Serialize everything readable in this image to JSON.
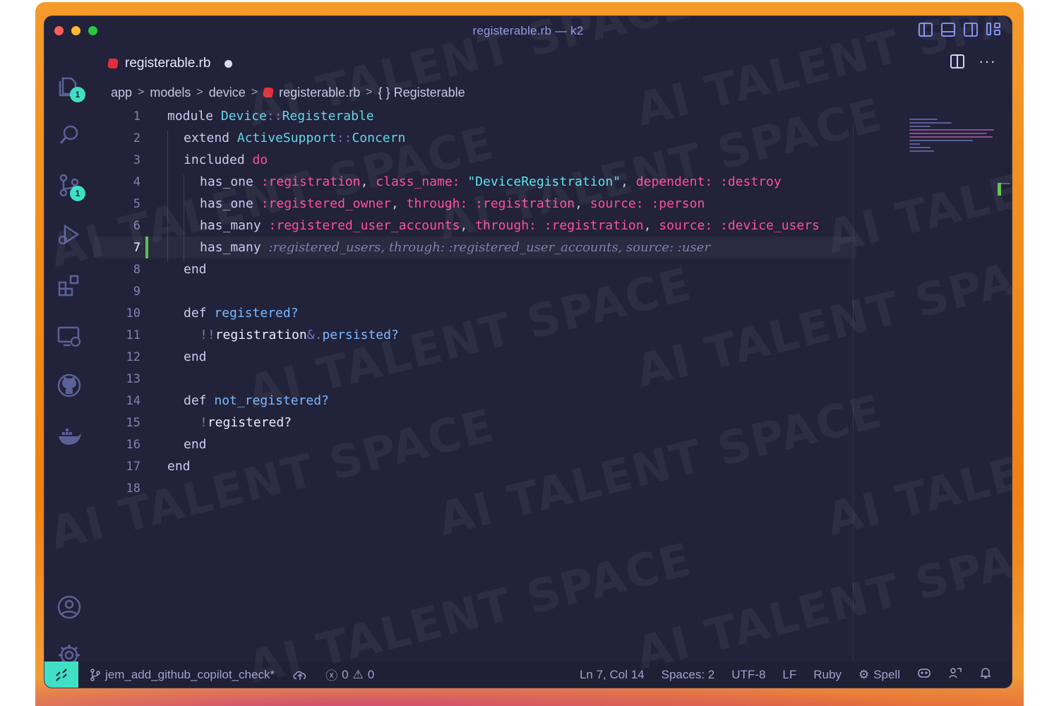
{
  "window": {
    "title": "registerable.rb — k2"
  },
  "tab": {
    "filename": "registerable.rb"
  },
  "breadcrumb": {
    "items": [
      "app",
      "models",
      "device",
      "registerable.rb",
      "{ } Registerable"
    ]
  },
  "activity": {
    "explorer_badge": "1",
    "scm_badge": "1"
  },
  "editor": {
    "lines": [
      {
        "num": "1"
      },
      {
        "num": "2"
      },
      {
        "num": "3"
      },
      {
        "num": "4"
      },
      {
        "num": "5"
      },
      {
        "num": "6"
      },
      {
        "num": "7"
      },
      {
        "num": "8"
      },
      {
        "num": "9"
      },
      {
        "num": "10"
      },
      {
        "num": "11"
      },
      {
        "num": "12"
      },
      {
        "num": "13"
      },
      {
        "num": "14"
      },
      {
        "num": "15"
      },
      {
        "num": "16"
      },
      {
        "num": "17"
      },
      {
        "num": "18"
      }
    ],
    "code": {
      "l1": [
        "module ",
        "Device",
        "::",
        "Registerable"
      ],
      "l2": [
        "extend ",
        "ActiveSupport",
        "::",
        "Concern"
      ],
      "l3": [
        "included ",
        "do"
      ],
      "l4": [
        "has_one ",
        ":registration",
        ", ",
        "class_name:",
        " ",
        "\"DeviceRegistration\"",
        ", ",
        "dependent:",
        " ",
        ":destroy"
      ],
      "l5": [
        "has_one ",
        ":registered_owner",
        ", ",
        "through:",
        " ",
        ":registration",
        ", ",
        "source:",
        " ",
        ":person"
      ],
      "l6": [
        "has_many ",
        ":registered_user_accounts",
        ", ",
        "through:",
        " ",
        ":registration",
        ", ",
        "source:",
        " ",
        ":device_users"
      ],
      "l7": [
        "has_many ",
        ":registered_users, through: :registered_user_accounts, source: :user"
      ],
      "l8": [
        "end"
      ],
      "l10": [
        "def ",
        "registered?"
      ],
      "l11": [
        "!!",
        "registration",
        "&.",
        "persisted?"
      ],
      "l12": [
        "end"
      ],
      "l14": [
        "def ",
        "not_registered?"
      ],
      "l15": [
        "!",
        "registered?"
      ],
      "l16": [
        "end"
      ],
      "l17": [
        "end"
      ]
    }
  },
  "status": {
    "branch": "jem_add_github_copilot_check*",
    "errors": "0",
    "warnings": "0",
    "position": "Ln 7, Col 14",
    "spaces": "Spaces: 2",
    "encoding": "UTF-8",
    "eol": "LF",
    "language": "Ruby",
    "spell": "Spell"
  },
  "watermark": "AI TALENT SPACE",
  "colors": {
    "accent": "#3fe0c5",
    "background": "#22223a",
    "symbol": "#ff4fa0",
    "string": "#59e4e8",
    "modified_bar": "#5ec24a"
  },
  "icons": [
    "files-icon",
    "search-icon",
    "source-control-icon",
    "run-debug-icon",
    "extensions-icon",
    "remote-explorer-icon",
    "github-icon",
    "docker-icon",
    "account-icon",
    "gear-icon"
  ]
}
